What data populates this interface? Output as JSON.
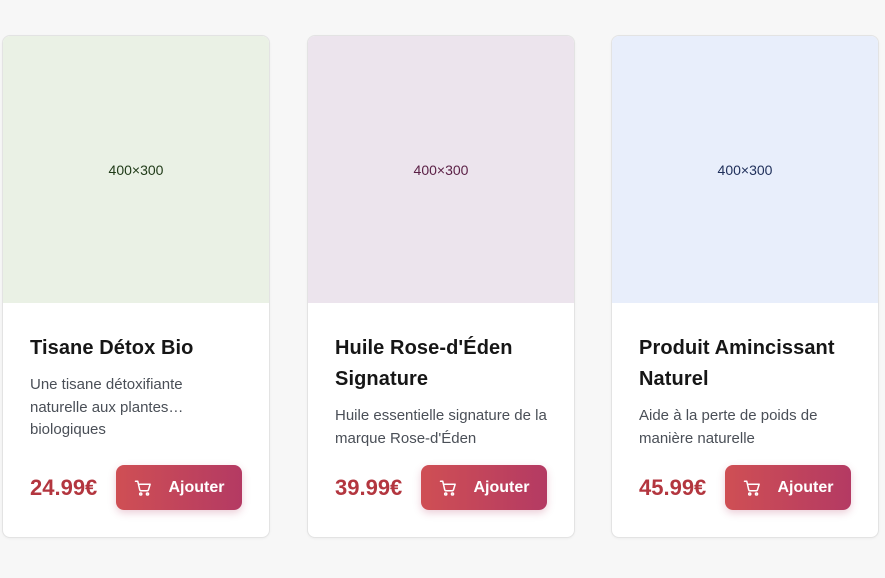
{
  "products": [
    {
      "image_label": "400×300",
      "image_bg": "#eaf1e5",
      "image_text_color": "#1f3a17",
      "title": "Tisane Détox Bio",
      "description": "Une tisane détoxifiante naturelle aux plantes… biologiques",
      "price": "24.99€",
      "button_label": "Ajouter",
      "button_icon": "cart-icon"
    },
    {
      "image_label": "400×300",
      "image_bg": "#ece4ed",
      "image_text_color": "#5a1f45",
      "title": "Huile Rose-d'Éden Signature",
      "description": "Huile essentielle signature de la marque Rose-d'Éden",
      "price": "39.99€",
      "button_label": "Ajouter",
      "button_icon": "cart-icon"
    },
    {
      "image_label": "400×300",
      "image_bg": "#e8eefb",
      "image_text_color": "#1f2f5a",
      "title": "Produit Amincissant Naturel",
      "description": "Aide à la perte de poids de manière naturelle",
      "price": "45.99€",
      "button_label": "Ajouter",
      "button_icon": "cart-icon"
    }
  ],
  "colors": {
    "page_bg": "#f7f7f7",
    "price": "#b3363f",
    "button_gradient_start": "#cf4f54",
    "button_gradient_end": "#b43a63"
  }
}
